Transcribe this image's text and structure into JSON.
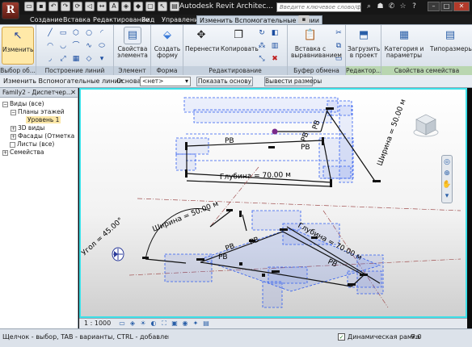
{
  "app": {
    "logo_letter": "R",
    "title": "Autodesk Revit Architec...",
    "search_placeholder": "Введите ключевое слово/фразу"
  },
  "tabs": [
    {
      "label": "Создание"
    },
    {
      "label": "Вставка"
    },
    {
      "label": "Редактирование"
    },
    {
      "label": "Вид"
    },
    {
      "label": "Управление"
    },
    {
      "label": "Изменить Вспомогательные линии"
    }
  ],
  "ribbon": {
    "modify_label": "Изменить",
    "panels": {
      "select": "Выбор об...",
      "draw": "Построение линий",
      "element": "Элемент",
      "form": "Форма",
      "edit": "Редактирование",
      "clipboard": "Буфер обмена",
      "editor": "Редактор...",
      "family_props": "Свойства семейства"
    },
    "buttons": {
      "element_props": "Свойства элемента",
      "create_form": "Создать форму",
      "move": "Перенести",
      "copy": "Копировать",
      "paste_aligned": "Вставка с выравниванием",
      "load_project": "Загрузить в проект",
      "categories": "Категория и параметры",
      "types": "Типоразмеры"
    }
  },
  "options_bar": {
    "context": "Изменить Вспомогательные линии",
    "base_label": "Основа:",
    "base_value": "<нет>",
    "show_base": "Показать основу",
    "show_dims": "Вывести размеры"
  },
  "browser": {
    "title": "Family2 - Диспетчер...",
    "nodes": [
      {
        "label": "Виды (все)"
      },
      {
        "label": "Планы этажей"
      },
      {
        "label": "Уровень 1"
      },
      {
        "label": "3D виды"
      },
      {
        "label": "Фасады (Отметка"
      },
      {
        "label": "Листы (все)"
      },
      {
        "label": "Семейства"
      }
    ]
  },
  "viewport": {
    "dim_labels": {
      "width_top": "Ширина = 50.00 м",
      "depth_top": "Глубина = 70.00 м",
      "angle": "Угол = 45.00°",
      "width_bottom": "Ширина = 50.00 м",
      "depth_bottom": "Глубина = 70.00 м",
      "rb": "РВ"
    }
  },
  "view_control": {
    "scale": "1 : 1000"
  },
  "status": {
    "hint": "Щелчок - выбор, TAB - варианты, CTRL - добавление, SHIFT - сн",
    "dynamic_frame": "Динамическая рамка",
    "filter_count": ":0"
  },
  "colors": {
    "accent_cyan": "#3ce0e8",
    "wall_blue": "#2f5cf0",
    "highlight_yellow": "#ffe9a8"
  }
}
